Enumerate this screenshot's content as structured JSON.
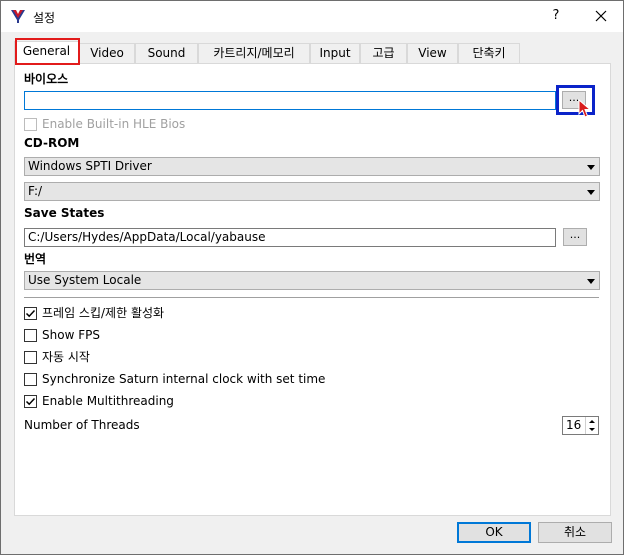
{
  "window": {
    "title": "설정",
    "help_label": "?"
  },
  "tabs": [
    {
      "label": "General",
      "active": true
    },
    {
      "label": "Video"
    },
    {
      "label": "Sound"
    },
    {
      "label": "카트리지/메모리"
    },
    {
      "label": "Input"
    },
    {
      "label": "고급"
    },
    {
      "label": "View"
    },
    {
      "label": "단축키"
    }
  ],
  "bios": {
    "section_label": "바이오스",
    "path_value": "",
    "browse_label": "...",
    "hle_label": "Enable Built-in HLE Bios",
    "hle_checked": false
  },
  "cdrom": {
    "section_label": "CD-ROM",
    "driver_selected": "Windows SPTI Driver",
    "drive_selected": "F:/"
  },
  "save_states": {
    "section_label": "Save States",
    "path_value": "C:/Users/Hydes/AppData/Local/yabause",
    "browse_label": "..."
  },
  "translation": {
    "section_label": "번역",
    "locale_selected": "Use System Locale"
  },
  "options": [
    {
      "label": "프레임 스킵/제한 활성화",
      "checked": true
    },
    {
      "label": "Show FPS",
      "checked": false
    },
    {
      "label": "자동 시작",
      "checked": false
    },
    {
      "label": "Synchronize Saturn internal clock with set time",
      "checked": false
    },
    {
      "label": "Enable Multithreading",
      "checked": true
    }
  ],
  "threads": {
    "label": "Number of Threads",
    "value": "16"
  },
  "footer": {
    "ok_label": "OK",
    "cancel_label": "취소"
  },
  "colors": {
    "accent": "#0078d7",
    "tab_highlight": "#e21b1b",
    "browse_highlight": "#0b23c9"
  },
  "icons": {
    "app": "yabause-logo-icon",
    "close": "close-icon",
    "cursor": "mouse-pointer-icon"
  }
}
